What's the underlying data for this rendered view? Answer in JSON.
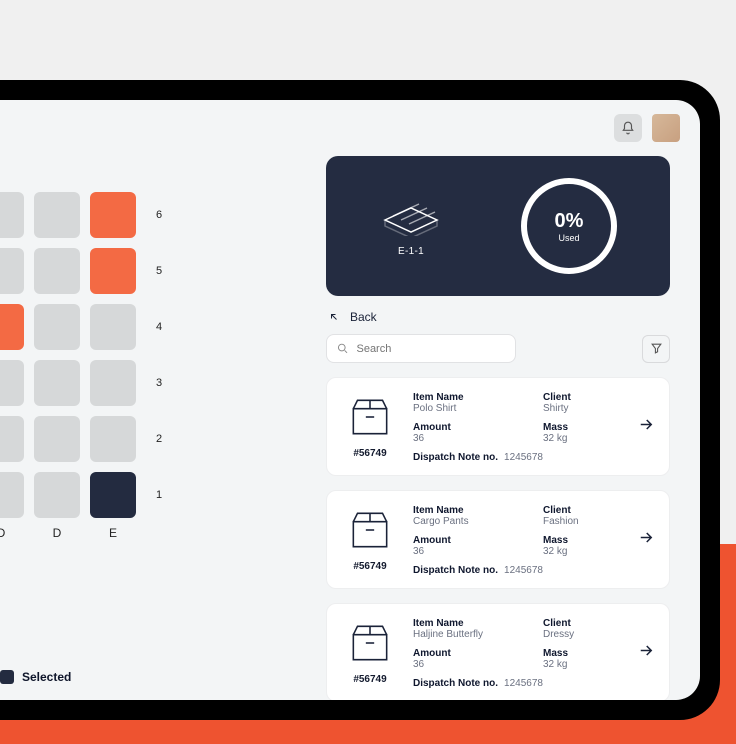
{
  "colors": {
    "accent": "#f36a44",
    "dark": "#232b40"
  },
  "legend": {
    "selected_label": "Selected"
  },
  "grid": {
    "row_labels": [
      "6",
      "5",
      "4",
      "3",
      "2",
      "1"
    ],
    "col_labels": [
      "",
      "",
      "",
      "D",
      "D",
      "E"
    ],
    "cells": [
      [
        "orange",
        "grey",
        "grey",
        "grey",
        "grey",
        "orange"
      ],
      [
        "orange",
        "grey",
        "grey",
        "grey",
        "grey",
        "orange"
      ],
      [
        "grey",
        "grey",
        "grey",
        "orange",
        "grey",
        "grey"
      ],
      [
        "orange",
        "grey",
        "grey",
        "grey",
        "grey",
        "grey"
      ],
      [
        "orange",
        "grey",
        "grey",
        "grey",
        "grey",
        "grey"
      ],
      [
        "hidden",
        "hidden",
        "grey",
        "grey",
        "grey",
        "dark"
      ]
    ]
  },
  "hero": {
    "id": "E-1-1",
    "percent": "0%",
    "percent_label": "Used"
  },
  "back": {
    "label": "Back"
  },
  "search": {
    "placeholder": "Search"
  },
  "labels": {
    "item_name": "Item Name",
    "client": "Client",
    "amount": "Amount",
    "mass": "Mass",
    "dispatch": "Dispatch Note no."
  },
  "items": [
    {
      "id": "#56749",
      "item_name": "Polo Shirt",
      "client": "Shirty",
      "amount": "36",
      "mass": "32 kg",
      "dispatch_no": "1245678"
    },
    {
      "id": "#56749",
      "item_name": "Cargo Pants",
      "client": "Fashion",
      "amount": "36",
      "mass": "32 kg",
      "dispatch_no": "1245678"
    },
    {
      "id": "#56749",
      "item_name": "Haljine Butterfly",
      "client": "Dressy",
      "amount": "36",
      "mass": "32 kg",
      "dispatch_no": "1245678"
    }
  ]
}
